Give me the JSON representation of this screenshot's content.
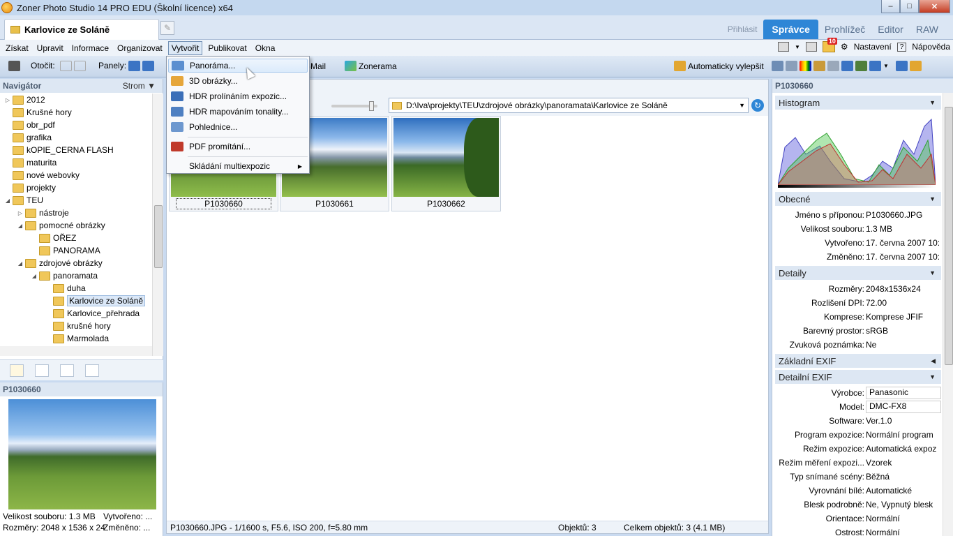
{
  "window": {
    "title": "Zoner Photo Studio 14 PRO EDU (Školní licence) x64",
    "minimize": "–",
    "maximize": "□",
    "close": "✕"
  },
  "tabbar": {
    "doc_tab": "Karlovice ze Soláně",
    "login": "Přihlásit",
    "modes": [
      "Správce",
      "Prohlížeč",
      "Editor",
      "RAW"
    ]
  },
  "menubar": {
    "items": [
      "Získat",
      "Upravit",
      "Informace",
      "Organizovat",
      "Vytvořit",
      "Publikovat",
      "Okna"
    ],
    "right": {
      "badge_count": "10",
      "settings": "Nastavení",
      "help": "Nápověda"
    }
  },
  "toolbar": {
    "rotate": "Otočit:",
    "panels": "Panely:",
    "email": "E-Mail",
    "zonerama": "Zonerama",
    "auto_enhance": "Automaticky vylepšit"
  },
  "navigator": {
    "title": "Navigátor",
    "view": "Strom",
    "tree": [
      {
        "label": "2012",
        "depth": 0,
        "arrow": "▷"
      },
      {
        "label": "Krušné hory",
        "depth": 0,
        "arrow": ""
      },
      {
        "label": "obr_pdf",
        "depth": 0,
        "arrow": ""
      },
      {
        "label": "grafika",
        "depth": 0,
        "arrow": ""
      },
      {
        "label": "kOPIE_CERNA FLASH",
        "depth": 0,
        "arrow": ""
      },
      {
        "label": "maturita",
        "depth": 0,
        "arrow": ""
      },
      {
        "label": "nové webovky",
        "depth": 0,
        "arrow": ""
      },
      {
        "label": "projekty",
        "depth": 0,
        "arrow": ""
      },
      {
        "label": "TEU",
        "depth": 0,
        "arrow": "◢"
      },
      {
        "label": "nástroje",
        "depth": 1,
        "arrow": "▷"
      },
      {
        "label": "pomocné obrázky",
        "depth": 1,
        "arrow": "◢"
      },
      {
        "label": "OŘEZ",
        "depth": 2,
        "arrow": ""
      },
      {
        "label": "PANORAMA",
        "depth": 2,
        "arrow": ""
      },
      {
        "label": "zdrojové obrázky",
        "depth": 1,
        "arrow": "◢"
      },
      {
        "label": "panoramata",
        "depth": 2,
        "arrow": "◢"
      },
      {
        "label": "duha",
        "depth": 3,
        "arrow": ""
      },
      {
        "label": "Karlovice ze Soláně",
        "depth": 3,
        "arrow": "",
        "selected": true
      },
      {
        "label": "Karlovice_přehrada",
        "depth": 3,
        "arrow": ""
      },
      {
        "label": "krušné hory",
        "depth": 3,
        "arrow": ""
      },
      {
        "label": "Marmolada",
        "depth": 3,
        "arrow": ""
      }
    ]
  },
  "preview": {
    "title": "P1030660",
    "info1": "Velikost souboru: 1.3 MB",
    "info2": "Rozměry: 2048 x 1536 x 24",
    "info3": "Vytvořeno: ...",
    "info4": "Změněno: ..."
  },
  "browser": {
    "path": "D:\\Iva\\projekty\\TEU\\zdrojové obrázky\\panoramata\\Karlovice ze Soláně",
    "thumbs": [
      "P1030660",
      "P1030661",
      "P1030662"
    ],
    "status": {
      "file": "P1030660.JPG - 1/1600 s, F5.6, ISO 200, f=5.80 mm",
      "objects": "Objektů: 3",
      "total": "Celkem objektů: 3 (4.1 MB)"
    }
  },
  "create_menu": {
    "items": [
      "Panoráma...",
      "3D obrázky...",
      "HDR prolínáním expozic...",
      "HDR mapováním tonality...",
      "Pohlednice...",
      "PDF promítání...",
      "Skládání multiexpozic"
    ],
    "submenu_arrow": "▶"
  },
  "info_panel": {
    "title": "P1030660",
    "sections": {
      "histogram": "Histogram",
      "general": "Obecné",
      "details": "Detaily",
      "basic_exif": "Základní EXIF",
      "detail_exif": "Detailní EXIF"
    },
    "general": [
      {
        "k": "Jméno s příponou:",
        "v": "P1030660.JPG"
      },
      {
        "k": "Velikost souboru:",
        "v": "1.3 MB"
      },
      {
        "k": "Vytvořeno:",
        "v": "17. června 2007 10:"
      },
      {
        "k": "Změněno:",
        "v": "17. června 2007 10:"
      }
    ],
    "details": [
      {
        "k": "Rozměry:",
        "v": "2048x1536x24"
      },
      {
        "k": "Rozlišení DPI:",
        "v": "72.00"
      },
      {
        "k": "Komprese:",
        "v": "Komprese JFIF"
      },
      {
        "k": "Barevný prostor:",
        "v": "sRGB"
      },
      {
        "k": "Zvuková poznámka:",
        "v": "Ne"
      }
    ],
    "exif": [
      {
        "k": "Výrobce:",
        "v": "Panasonic"
      },
      {
        "k": "Model:",
        "v": "DMC-FX8"
      },
      {
        "k": "Software:",
        "v": "Ver.1.0"
      },
      {
        "k": "Program expozice:",
        "v": "Normální program"
      },
      {
        "k": "Režim expozice:",
        "v": "Automatická expoz"
      },
      {
        "k": "Režim měření expozi...",
        "v": "Vzorek"
      },
      {
        "k": "Typ snímané scény:",
        "v": "Běžná"
      },
      {
        "k": "Vyrovnání bílé:",
        "v": "Automatické"
      },
      {
        "k": "Blesk podrobně:",
        "v": "Ne, Vypnutý blesk"
      },
      {
        "k": "Orientace:",
        "v": "Normální"
      },
      {
        "k": "Ostrost:",
        "v": "Normální"
      }
    ]
  }
}
